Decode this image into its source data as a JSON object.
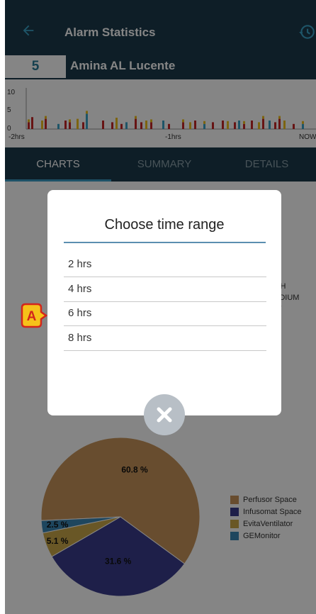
{
  "header": {
    "title": "Alarm Statistics"
  },
  "patient": {
    "bed": "5",
    "name": "Amina AL Lucente"
  },
  "timeline": {
    "y_ticks": [
      "10",
      "5",
      "0"
    ],
    "x_ticks": [
      "-2hrs",
      "-1hrs",
      "NOW"
    ]
  },
  "tabs": [
    {
      "label": "CHARTS",
      "active": true
    },
    {
      "label": "SUMMARY",
      "active": false
    },
    {
      "label": "DETAILS",
      "active": false
    }
  ],
  "severity_legend": [
    "GH",
    "EDIUM",
    "W"
  ],
  "pie_legend": [
    {
      "label": "Perfusor Space",
      "color": "#c8955a"
    },
    {
      "label": "Infusomat Space",
      "color": "#3a3d8c"
    },
    {
      "label": "EvitaVentilator",
      "color": "#c9a84a"
    },
    {
      "label": "GEMonitor",
      "color": "#3b86b5"
    }
  ],
  "chart_data": {
    "type": "pie",
    "categories": [
      "Perfusor Space",
      "Infusomat Space",
      "EvitaVentilator",
      "GEMonitor"
    ],
    "values": [
      60.8,
      31.6,
      5.1,
      2.5
    ],
    "labels": [
      "60.8 %",
      "31.6 %",
      "5.1 %",
      "2.5 %"
    ]
  },
  "dialog": {
    "title": "Choose time range",
    "options": [
      "2 hrs",
      "4 hrs",
      "6 hrs",
      "8 hrs"
    ]
  },
  "callout": {
    "letter": "A",
    "color": "#f6c21a",
    "outline": "#d3261c"
  }
}
